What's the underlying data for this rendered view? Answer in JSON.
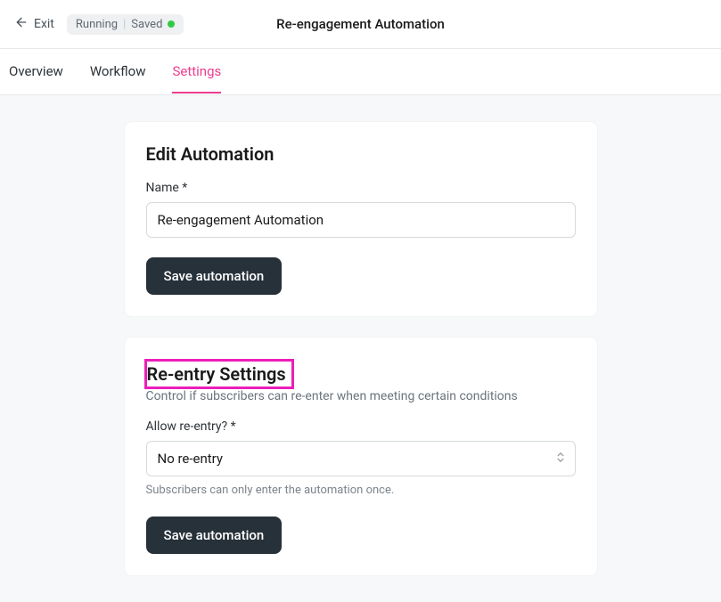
{
  "header": {
    "exit_label": "Exit",
    "badge_status": "Running",
    "badge_saved": "Saved",
    "page_title": "Re-engagement Automation"
  },
  "tabs": [
    {
      "label": "Overview",
      "active": false
    },
    {
      "label": "Workflow",
      "active": false
    },
    {
      "label": "Settings",
      "active": true
    }
  ],
  "card_edit": {
    "heading": "Edit Automation",
    "name_label": "Name *",
    "name_value": "Re-engagement Automation",
    "save_label": "Save automation"
  },
  "card_reentry": {
    "heading": "Re-entry Settings",
    "subtitle": "Control if subscribers can re-enter when meeting certain conditions",
    "allow_label": "Allow re-entry? *",
    "allow_value": "No re-entry",
    "helper": "Subscribers can only enter the automation once.",
    "save_label": "Save automation"
  }
}
